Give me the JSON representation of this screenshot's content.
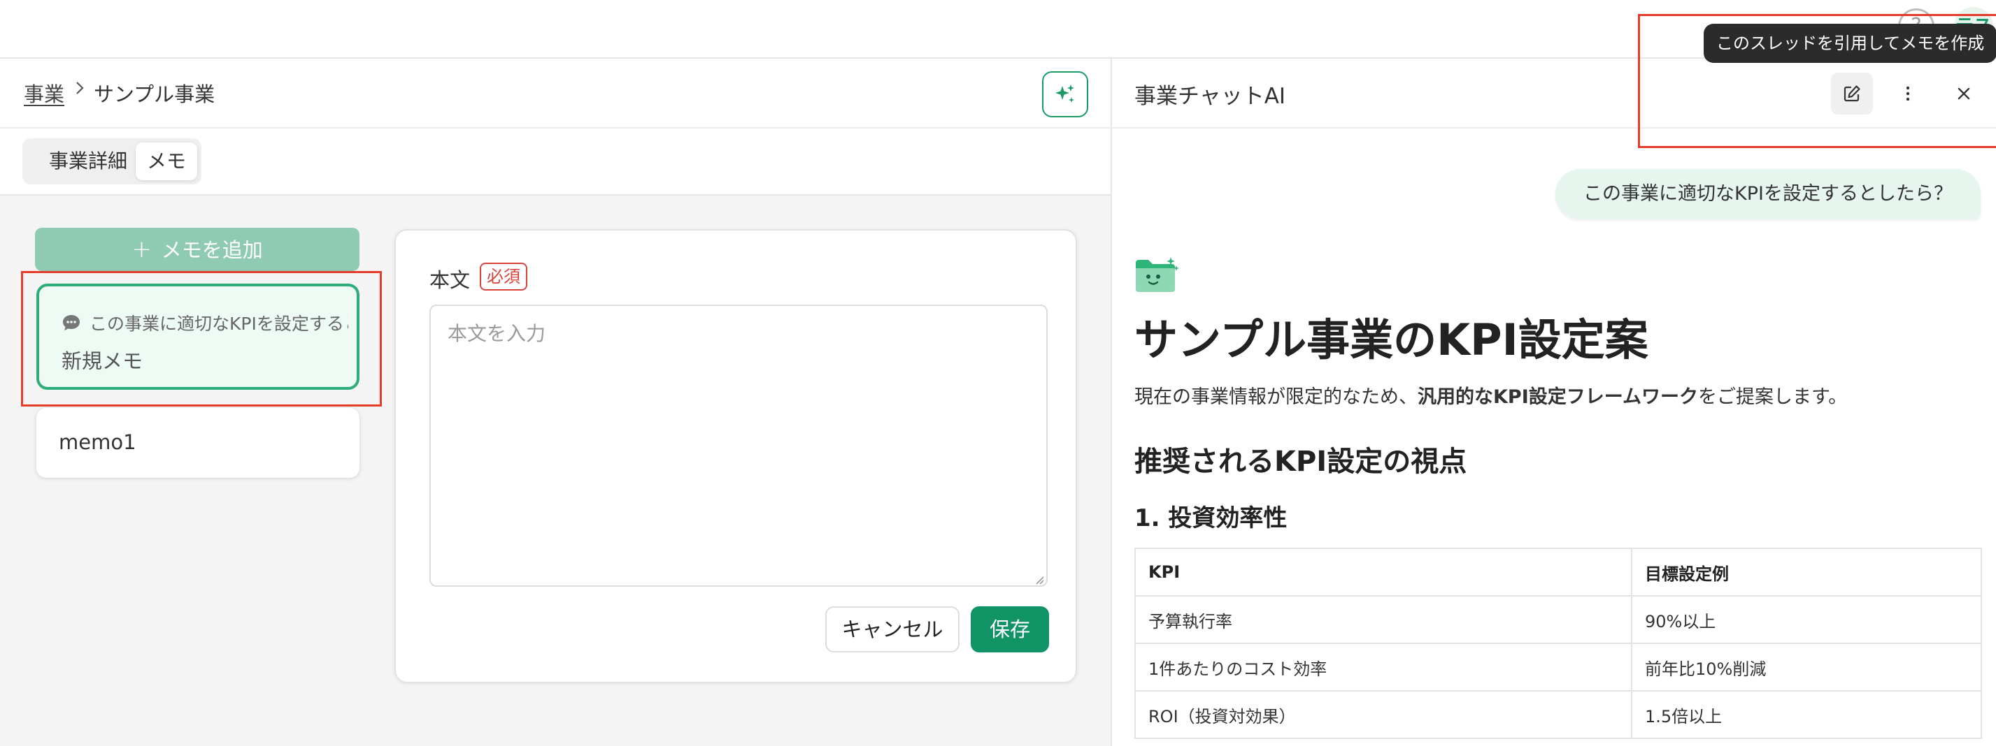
{
  "header": {
    "help_icon": "question-circle-icon",
    "avatar_initials": "テス"
  },
  "breadcrumb": {
    "parent": "事業",
    "current": "サンプル事業"
  },
  "tabs": [
    {
      "label": "事業詳細",
      "active": false
    },
    {
      "label": "メモ",
      "active": true
    }
  ],
  "memo_list": {
    "add_button_label": "メモを追加",
    "items": [
      {
        "quote": "この事業に適切なKPIを設定するとしたら？",
        "title": "新規メモ",
        "selected": true
      },
      {
        "title": "memo1",
        "selected": false
      }
    ]
  },
  "editor": {
    "field_label": "本文",
    "required_label": "必須",
    "placeholder": "本文を入力",
    "value": "",
    "cancel_label": "キャンセル",
    "save_label": "保存"
  },
  "chat": {
    "title": "事業チャットAI",
    "tooltip": "このスレッドを引用してメモを作成",
    "user_message": "この事業に適切なKPIを設定するとしたら？",
    "response": {
      "heading": "サンプル事業のKPI設定案",
      "intro_before": "現在の事業情報が限定的なため、",
      "intro_bold": "汎用的なKPI設定フレームワーク",
      "intro_after": "をご提案します。",
      "section_heading": "推奨されるKPI設定の視点",
      "subsection_heading": "1. 投資効率性",
      "table": {
        "headers": [
          "KPI",
          "目標設定例"
        ],
        "rows": [
          [
            "予算執行率",
            "90%以上"
          ],
          [
            "1件あたりのコスト効率",
            "前年比10%削減"
          ],
          [
            "ROI（投資対効果）",
            "1.5倍以上"
          ]
        ]
      }
    }
  },
  "colors": {
    "accent": "#109465",
    "accent_light": "#8fcbb2",
    "highlight": "#e53c2a",
    "selected_bg": "#eefaf4"
  }
}
